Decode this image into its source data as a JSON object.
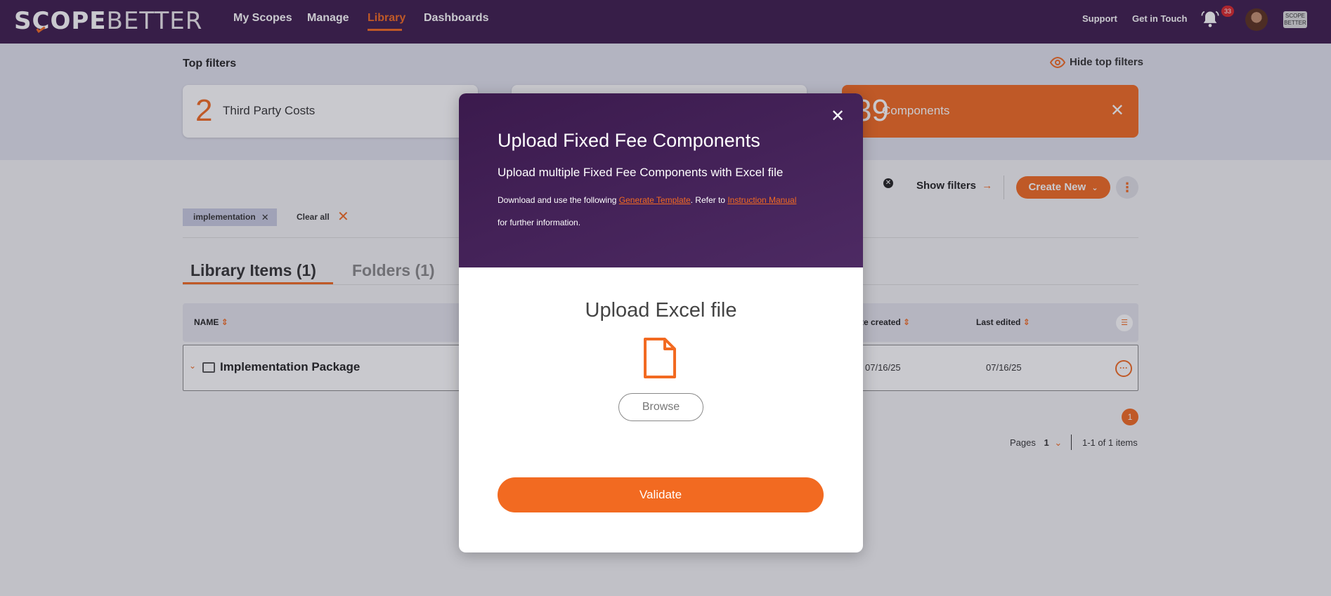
{
  "brand": {
    "logo_bold": "SCOPE",
    "logo_thin": "BETTER",
    "accent": "#f26a21",
    "nav_bg": "#3d1b4d"
  },
  "nav": {
    "items": [
      {
        "label": "My Scopes"
      },
      {
        "label": "Manage"
      },
      {
        "label": "Library"
      },
      {
        "label": "Dashboards"
      }
    ],
    "active": "Library",
    "support": "Support",
    "get_in_touch": "Get in Touch",
    "notification_count": "33",
    "mini_logo": "SCOPE BETTER"
  },
  "top_filters": {
    "title": "Top filters",
    "hide_label": "Hide top filters",
    "cards": [
      {
        "count": "2",
        "label": "Third Party Costs"
      },
      {
        "count": "",
        "label": ""
      },
      {
        "count": "39",
        "label": "Components"
      }
    ]
  },
  "toolbar": {
    "show_filters": "Show filters",
    "create_new": "Create New",
    "active_chip": "implementation",
    "clear_all": "Clear all"
  },
  "tabs": [
    {
      "label": "Library Items (1)"
    },
    {
      "label": "Folders (1)"
    }
  ],
  "table": {
    "columns": [
      "NAME",
      "te created",
      "Last edited"
    ],
    "rows": [
      {
        "name": "Implementation Package",
        "created": "07/16/25",
        "edited": "07/16/25"
      }
    ]
  },
  "pagination": {
    "current_badge": "1",
    "pages_label": "Pages",
    "page": "1",
    "summary": "1-1 of 1 items"
  },
  "modal": {
    "title": "Upload Fixed Fee Components",
    "subtitle": "Upload multiple Fixed Fee Components with Excel file",
    "info_prefix": "Download and use the following ",
    "info_link1": "Generate Template",
    "info_mid": ". Refer to ",
    "info_link2": "Instruction Manual",
    "info_suffix": " for further information.",
    "upload_title": "Upload Excel file",
    "browse": "Browse",
    "validate": "Validate",
    "close_glyph": "✕"
  }
}
